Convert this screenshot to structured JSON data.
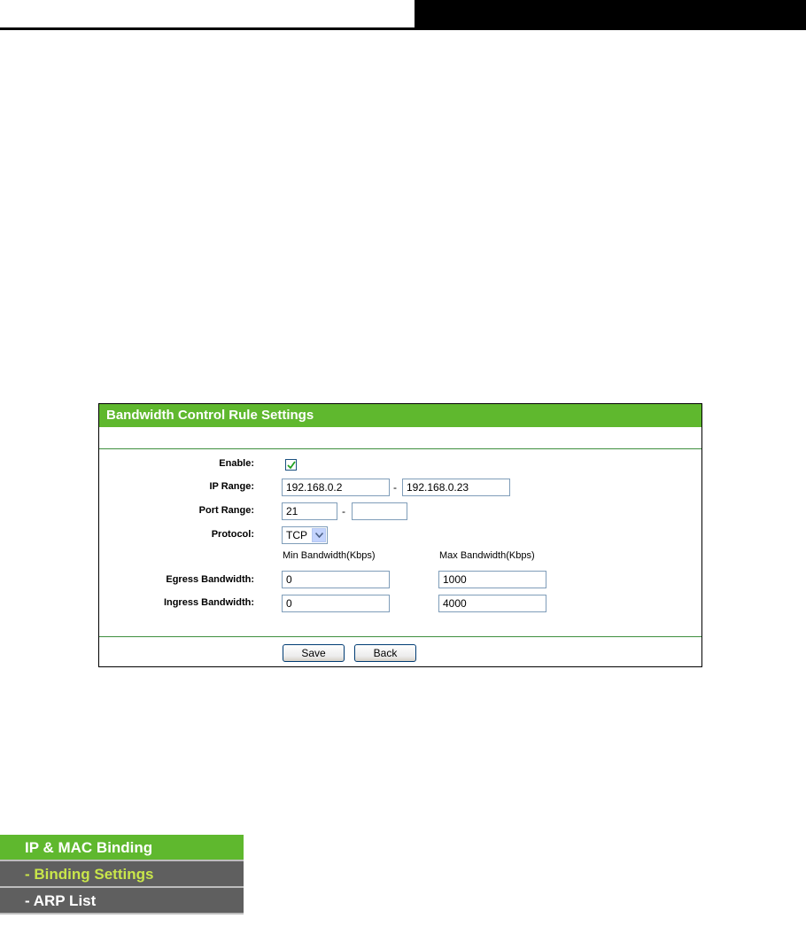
{
  "panel": {
    "title": "Bandwidth Control Rule Settings",
    "enable_label": "Enable:",
    "enable_checked": true,
    "ip_range_label": "IP Range:",
    "ip_start": "192.168.0.2",
    "ip_sep": "-",
    "ip_end": "192.168.0.23",
    "port_range_label": "Port Range:",
    "port_start": "21",
    "port_sep": "-",
    "port_end": "",
    "protocol_label": "Protocol:",
    "protocol_value": "TCP",
    "min_bw_header": "Min Bandwidth(Kbps)",
    "max_bw_header": "Max Bandwidth(Kbps)",
    "egress_label": "Egress Bandwidth:",
    "egress_min": "0",
    "egress_max": "1000",
    "ingress_label": "Ingress Bandwidth:",
    "ingress_min": "0",
    "ingress_max": "4000",
    "save_label": "Save",
    "back_label": "Back"
  },
  "menu": {
    "items": [
      {
        "label": "IP & MAC Binding"
      },
      {
        "label": "- Binding Settings"
      },
      {
        "label": "- ARP List"
      }
    ]
  },
  "colors": {
    "accent": "#5fb82e",
    "menu_bg": "#5f5f5f",
    "menu_current": "#c9e64a"
  }
}
